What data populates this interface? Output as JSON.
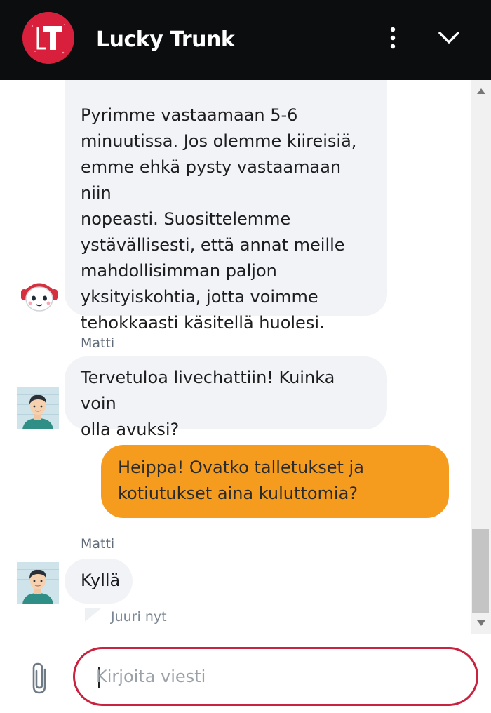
{
  "header": {
    "title": "Lucky Trunk",
    "logo_letter": "T",
    "logo_color": "#d81f3b",
    "menu_icon": "more-vertical-icon",
    "collapse_icon": "chevron-down-icon"
  },
  "messages": [
    {
      "from": "bot",
      "sender": "",
      "text": "Pyrimme vastaamaan 5-6\nminuutissa. Jos olemme kiireisiä,\nemme ehkä pysty vastaamaan niin\nnopeasti. Suosittelemme\nystävällisesti, että annat meille\nmahdollisimman paljon\nyksityiskohtia, jotta voimme\ntehokkaasti käsitellä huolesi."
    },
    {
      "from": "agent",
      "sender": "Matti",
      "text": "Tervetuloa livechattiin! Kuinka voin\nolla avuksi?"
    },
    {
      "from": "user",
      "sender": "",
      "text": "Heippa! Ovatko talletukset ja\nkotiutukset aina kuluttomia?"
    },
    {
      "from": "agent",
      "sender": "Matti",
      "text": "Kyllä"
    }
  ],
  "last_timestamp": "Juuri nyt",
  "composer": {
    "placeholder": "Kirjoita viesti",
    "value": "",
    "attach_icon": "paperclip-icon"
  },
  "colors": {
    "header_bg": "#0b0d0f",
    "user_bubble": "#f59c1f",
    "agent_bubble": "#f1f3f6",
    "input_border": "#c8243f"
  }
}
